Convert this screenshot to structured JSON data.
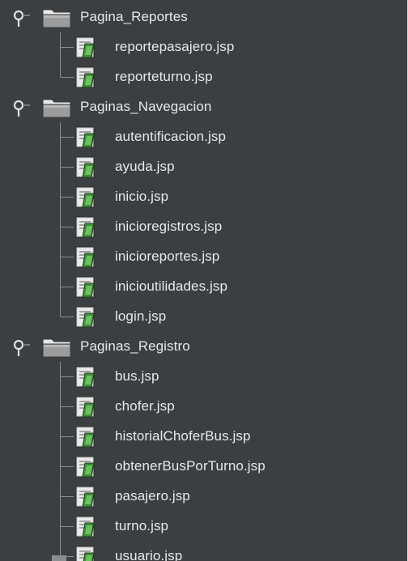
{
  "tree": {
    "groups": [
      {
        "name": "Pagina_Reportes",
        "files": [
          "reportepasajero.jsp",
          "reporteturno.jsp"
        ]
      },
      {
        "name": "Paginas_Navegacion",
        "files": [
          "autentificacion.jsp",
          "ayuda.jsp",
          "inicio.jsp",
          "inicioregistros.jsp",
          "inicioreportes.jsp",
          "inicioutilidades.jsp",
          "login.jsp"
        ]
      },
      {
        "name": "Paginas_Registro",
        "files": [
          "bus.jsp",
          "chofer.jsp",
          "historialChoferBus.jsp",
          "obtenerBusPorTurno.jsp",
          "pasajero.jsp",
          "turno.jsp",
          "usuario.jsp"
        ]
      }
    ]
  },
  "icons": {
    "expander": "expanded-handle-icon",
    "folder": "folder-icon",
    "file": "jsp-file-icon"
  },
  "colors": {
    "background": "#3c3f41",
    "text": "#e8e8e8",
    "tree_line": "#8b8d8f",
    "file_icon_green": "#3e8e3a"
  }
}
